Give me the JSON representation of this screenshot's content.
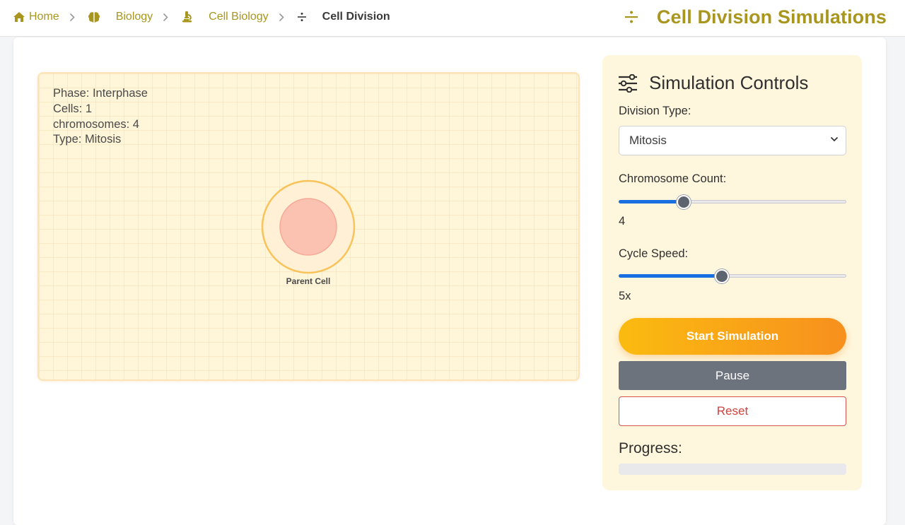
{
  "breadcrumb": {
    "items": [
      {
        "label": "Home",
        "icon": "home-icon"
      },
      {
        "label": "Biology",
        "icon": "brain-icon"
      },
      {
        "label": "Cell Biology",
        "icon": "microscope-icon"
      },
      {
        "label": "Cell Division",
        "icon": "divide-icon"
      }
    ]
  },
  "header": {
    "title": "Cell Division Simulations",
    "icon": "divide-icon"
  },
  "simulation": {
    "phase": "Phase: Interphase",
    "cells": "Cells: 1",
    "chromosomes": "chromosomes: 4",
    "type": "Type: Mitosis",
    "cell_label": "Parent Cell"
  },
  "controls": {
    "title": "Simulation Controls",
    "division_type_label": "Division Type:",
    "division_type_value": "Mitosis",
    "chromosome_label": "Chromosome Count:",
    "chromosome_value": "4",
    "chromosome_fraction": 0.27,
    "speed_label": "Cycle Speed:",
    "speed_value": "5x",
    "speed_fraction": 0.45,
    "start_label": "Start Simulation",
    "pause_label": "Pause",
    "reset_label": "Reset",
    "progress_label": "Progress:",
    "progress_fraction": 0
  },
  "colors": {
    "accent": "#a8961f",
    "canvas_bg": "#fff5d9",
    "panel_bg": "#fff7dd",
    "cell_membrane": "#f8c35a",
    "nucleus": "#fbc2b2",
    "slider_fill": "#1a6fe0",
    "pause_bg": "#6c737d",
    "reset_red": "#d9534f"
  }
}
